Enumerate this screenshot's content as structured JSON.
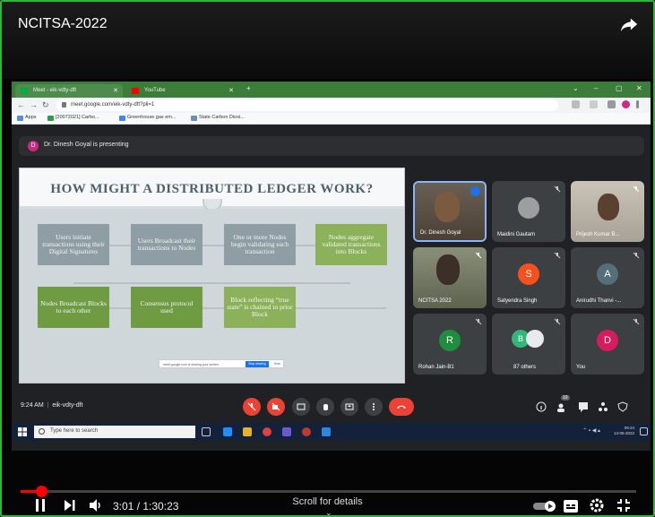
{
  "video": {
    "title": "NCITSA-2022"
  },
  "browser": {
    "tabs": [
      {
        "label": "Meet - eik-vdty-dft",
        "active": true
      },
      {
        "label": "YouTube",
        "active": false
      }
    ],
    "url": "meet.google.com/eik-vdty-dft?pli=1",
    "bookmarks": [
      "Apps",
      "[20072021] Carbo...",
      "Greenhouse gas em...",
      "State Carbon Dioxi..."
    ]
  },
  "meet": {
    "presenting_initial": "D",
    "presenting_text": "Dr. Dinesh Goyal is presenting",
    "meeting_time": "9:24 AM",
    "meeting_code": "eik-vdty-dft",
    "participant_count_badge": "10"
  },
  "slide": {
    "title": "HOW MIGHT A DISTRIBUTED LEDGER WORK?",
    "row1": [
      {
        "text": "Users initiate transactions using their Digital Signatures"
      },
      {
        "text": "Users Broadcast their transactions to Nodes"
      },
      {
        "text": "One or more Nodes begin validating each transaction"
      },
      {
        "text": "Nodes aggregate validated transactions into Blocks"
      }
    ],
    "row2": [
      {
        "text": "Nodes Broadcast Blocks to each other"
      },
      {
        "text": "Consensus protocol used"
      },
      {
        "text": "Block reflecting “true state” is chained to prior Block"
      }
    ],
    "share_bar_text": "meet.google.com is sharing your screen.",
    "share_stop": "Stop sharing",
    "share_hide": "Hide"
  },
  "participants": [
    {
      "name": "Dr. Dinesh Goyal",
      "type": "video"
    },
    {
      "name": "Maidini Gautam",
      "type": "photo"
    },
    {
      "name": "Prijesh Kumar B...",
      "type": "video"
    },
    {
      "name": "NCITSA 2022",
      "type": "video"
    },
    {
      "name": "Satyendra Singh",
      "initial": "S",
      "color": "#f4511e"
    },
    {
      "name": "Anirudhi Thanvi -...",
      "initial": "A",
      "color": "#546e7a"
    },
    {
      "name": "Rohan Jain-B1",
      "initial": "R",
      "color": "#1e8e3e"
    },
    {
      "name": "87 others",
      "initial": "B",
      "color": "#33b679"
    },
    {
      "name": "You",
      "initial": "D",
      "color": "#d81b60"
    }
  ],
  "taskbar": {
    "search_placeholder": "Type here to search",
    "clock_time": "09:24",
    "clock_date": "14-05-2022"
  },
  "player": {
    "current_time": "3:01",
    "duration": "1:30:23",
    "time_separator": " / ",
    "progress_fraction": 0.033,
    "scroll_hint": "Scroll for details"
  },
  "colors": {
    "border_green": "#2db83d",
    "progress_red": "#ff0000",
    "end_call_red": "#ea4335"
  }
}
